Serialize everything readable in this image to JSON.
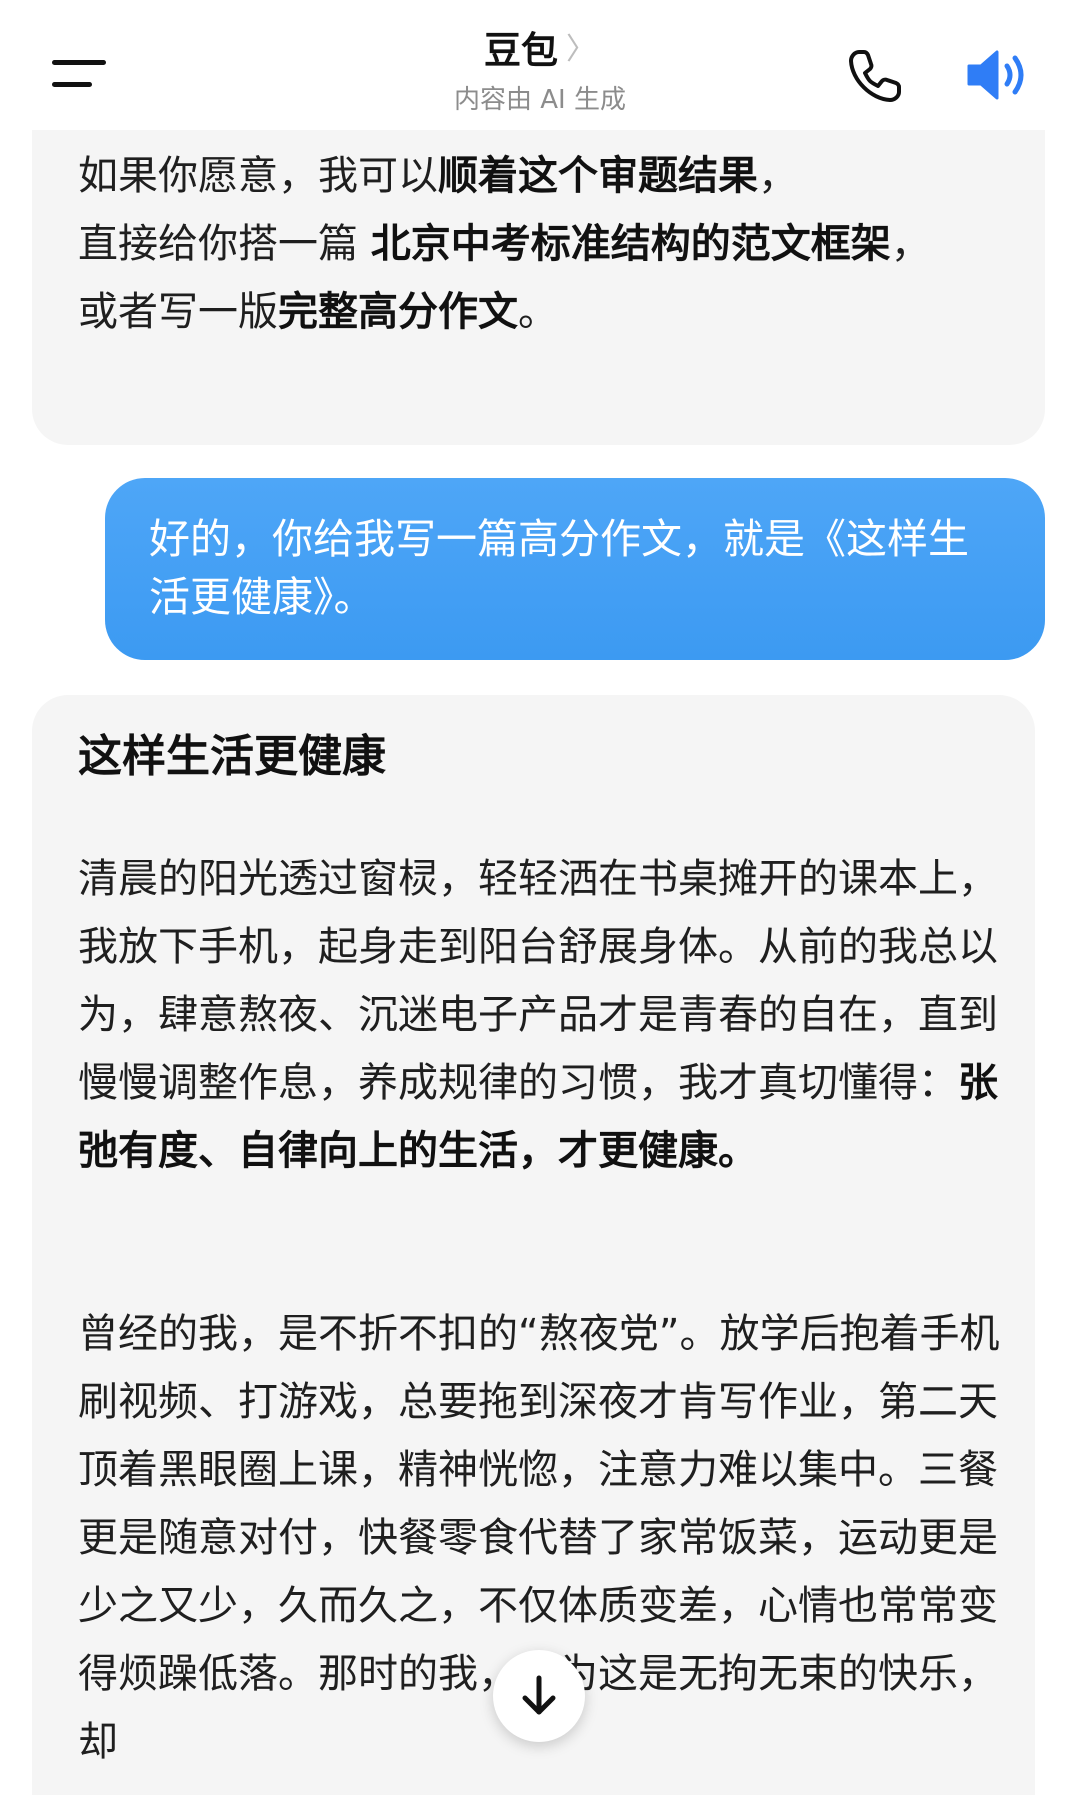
{
  "header": {
    "title": "豆包",
    "chevron": "〉",
    "subtitle": "内容由 AI 生成",
    "icons": [
      "menu-icon",
      "phone-icon",
      "speaker-icon"
    ]
  },
  "ai_message_1": {
    "line1_normal": "如果你愿意，我可以",
    "line1_bold": "顺着这个审题结果",
    "line1_end": "，",
    "line2_normal": "直接给你搭一篇 ",
    "line2_bold": "北京中考标准结构的范文框架",
    "line2_end": "，",
    "line3_normal": "或者写一版",
    "line3_bold": "完整高分作文",
    "line3_end": "。"
  },
  "user_message": {
    "text": "好的，你给我写一篇高分作文，就是《这样生活更健康》。"
  },
  "ai_message_2": {
    "essay_title": "这样生活更健康",
    "para1_normal": "清晨的阳光透过窗棂，轻轻洒在书桌摊开的课本上，我放下手机，起身走到阳台舒展身体。从前的我总以为，肆意熬夜、沉迷电子产品才是青春的自在，直到慢慢调整作息，养成规律的习惯，我才真切懂得：",
    "para1_bold": "张弛有度、自律向上的生活，才更健康。",
    "para2": "曾经的我，是不折不扣的“熬夜党”。放学后抱着手机刷视频、打游戏，总要拖到深夜才肯写作业，第二天顶着黑眼圈上课，精神恍惚，注意力难以集中。三餐更是随意对付，快餐零食代替了家常饭菜，运动更是少之又少，久而久之，不仅体质变差，心情也常常变得烦躁低落。那时的我，以为这是无拘无束的快乐，却"
  },
  "colors": {
    "user_bubble": "#3c9af2",
    "ai_bubble": "#f5f5f5",
    "speaker_blue": "#2f7df6"
  }
}
